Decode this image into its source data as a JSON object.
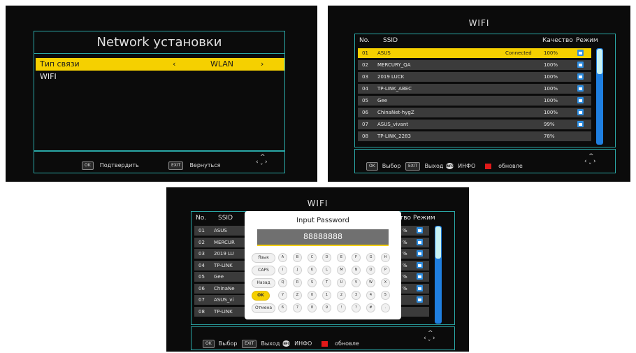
{
  "network": {
    "title": "Network установки",
    "rows": [
      {
        "label": "Тип связи",
        "left": "‹",
        "value": "WLAN",
        "right": "›"
      },
      {
        "label": "WIFI"
      }
    ],
    "footer": {
      "ok_key": "OK",
      "ok_label": "Подтвердить",
      "exit_key": "EXIT",
      "exit_label": "Вернуться",
      "nav_icon": "navigation-arrows-icon"
    }
  },
  "wifi": {
    "title": "WIFI",
    "headers": {
      "no": "No.",
      "ssid": "SSID",
      "quality": "Качество",
      "mode": "Режим"
    },
    "networks": [
      {
        "no": "01",
        "ssid": "ASUS",
        "status": "Connected",
        "quality": "100%",
        "locked": true
      },
      {
        "no": "02",
        "ssid": "MERCURY_QA",
        "status": "",
        "quality": "100%",
        "locked": true
      },
      {
        "no": "03",
        "ssid": "2019 LUCK",
        "status": "",
        "quality": "100%",
        "locked": true
      },
      {
        "no": "04",
        "ssid": "TP-LINK_ABEC",
        "status": "",
        "quality": "100%",
        "locked": true
      },
      {
        "no": "05",
        "ssid": "Gee",
        "status": "",
        "quality": "100%",
        "locked": true
      },
      {
        "no": "06",
        "ssid": "ChinaNet-hygZ",
        "status": "",
        "quality": "100%",
        "locked": true
      },
      {
        "no": "07",
        "ssid": "ASUS_vivant",
        "status": "",
        "quality": "99%",
        "locked": true
      },
      {
        "no": "08",
        "ssid": "TP-LINK_2283",
        "status": "",
        "quality": "78%",
        "locked": false
      }
    ],
    "dialog_list": {
      "ssids": [
        "ASUS",
        "MERCUR",
        "2019 LU",
        "TP-LINK",
        "Gee",
        "ChinaNe",
        "ASUS_vi",
        "TP-LINK"
      ],
      "quality_partial": "тво",
      "quality_fragments": [
        "%",
        "%",
        "%",
        "%",
        "%",
        "%",
        "",
        ""
      ]
    },
    "footer": {
      "ok_key": "OK",
      "ok_label": "Выбор",
      "exit_key": "EXIT",
      "exit_label": "Выход",
      "info_key": "INFO",
      "info_label": "ИНФО",
      "red_label": "обновле",
      "nav_icon": "navigation-arrows-icon"
    },
    "scroll_position": 0.3
  },
  "password_dialog": {
    "title": "Input Password",
    "value": "88888888",
    "function_keys": [
      "Язык",
      "CAPS",
      "Назад",
      "OK",
      "Отмена"
    ],
    "key_rows": [
      [
        "A",
        "B",
        "C",
        "D",
        "E",
        "F",
        "G",
        "H"
      ],
      [
        "I",
        "J",
        "K",
        "L",
        "M",
        "N",
        "O",
        "P"
      ],
      [
        "Q",
        "R",
        "S",
        "T",
        "U",
        "V",
        "W",
        "X"
      ],
      [
        "Y",
        "Z",
        "0",
        "1",
        "2",
        "3",
        "4",
        "5"
      ],
      [
        "6",
        "7",
        "8",
        "9",
        "!",
        "?",
        "#",
        "."
      ]
    ]
  }
}
